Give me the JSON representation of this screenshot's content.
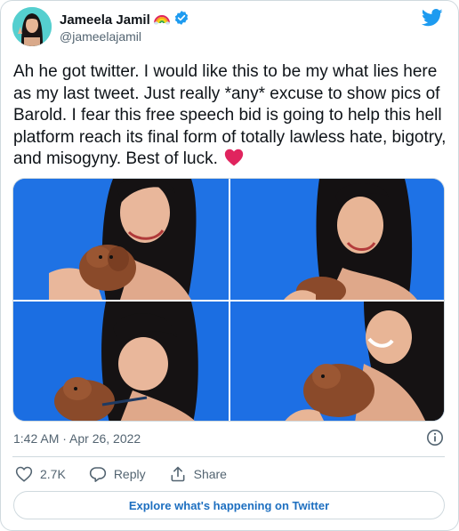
{
  "author": {
    "display_name": "Jameela Jamil",
    "handle": "@jameelajamil",
    "badge_emoji": "rainbow-emoji",
    "verified_icon": "verified-badge-icon"
  },
  "brand": {
    "logo": "twitter-bird-icon",
    "color": "#1d9bf0"
  },
  "tweet": {
    "text": "Ah he got twitter. I would like this to be my what lies here as my last tweet. Just really *any* excuse to show pics of Barold. I fear this free speech bid is going to help this hell platform reach its final form of totally lawless hate, bigotry, and misogyny. Best of luck.",
    "trailing_emoji": "red-heart-emoji",
    "timestamp": "1:42 AM · Apr 26, 2022"
  },
  "media": {
    "photo_count": 4,
    "background_color": "#1e6fe0"
  },
  "actions": {
    "likes": "2.7K",
    "reply_label": "Reply",
    "share_label": "Share"
  },
  "footer": {
    "explore_label": "Explore what's happening on Twitter"
  },
  "colors": {
    "text_primary": "#0f1419",
    "text_secondary": "#536471",
    "border": "#cfd9de",
    "link": "#1d6fc0",
    "heart": "#e0245e"
  }
}
